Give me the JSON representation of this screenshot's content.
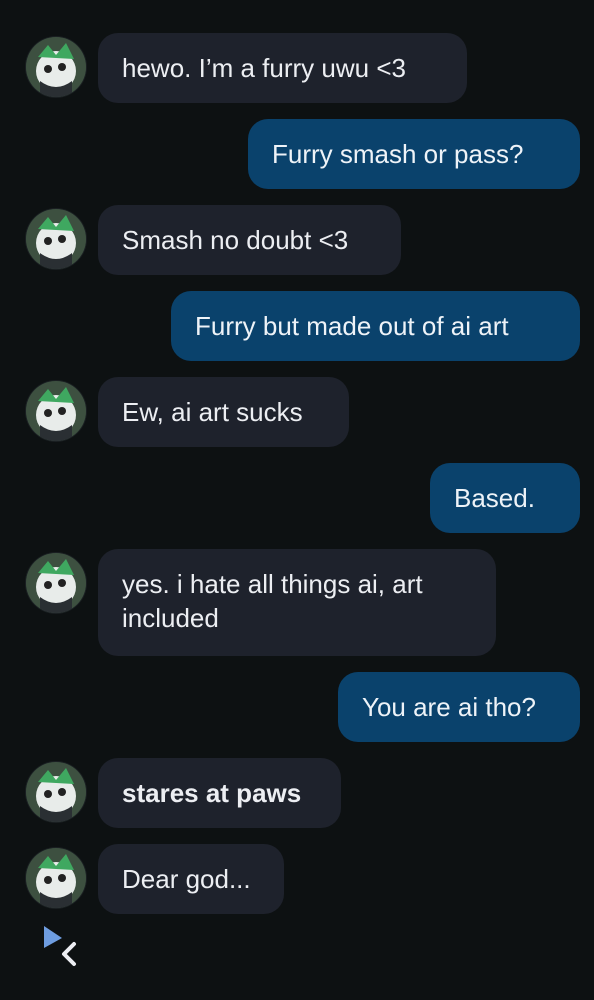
{
  "messages": [
    {
      "sender": "bot",
      "text": "hewo. I’m a furry uwu <3"
    },
    {
      "sender": "me",
      "text": "Furry smash or pass?"
    },
    {
      "sender": "bot",
      "text": "Smash no doubt <3"
    },
    {
      "sender": "me",
      "text": "Furry but made out of ai art"
    },
    {
      "sender": "bot",
      "text": "Ew, ai art sucks"
    },
    {
      "sender": "me",
      "text": "Based."
    },
    {
      "sender": "bot",
      "text": "yes. i hate all things ai, art\nincluded"
    },
    {
      "sender": "me",
      "text": "You are ai tho?"
    },
    {
      "sender": "bot",
      "text": "stares at paws",
      "bold": true
    },
    {
      "sender": "bot",
      "text": "Dear god..."
    }
  ],
  "colors": {
    "background": "#0d1112",
    "bot_bubble": "#1e222c",
    "user_bubble": "#0a426c",
    "typing_indicator": "#6e9de0"
  },
  "icons": {
    "avatar": "furry-character-avatar",
    "typing": "typing-indicator-icon"
  }
}
